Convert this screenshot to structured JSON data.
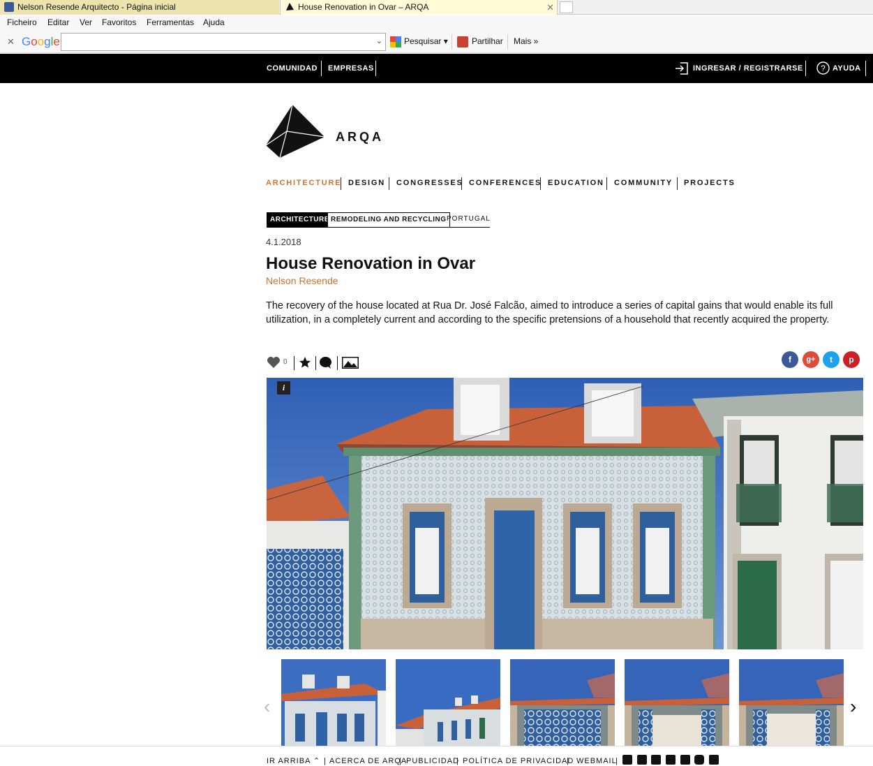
{
  "browser": {
    "tabs": [
      {
        "label": "Nelson Resende Arquitecto - Página inicial"
      },
      {
        "label": "House Renovation in Ovar – ARQA"
      }
    ],
    "menu": [
      "Ficheiro",
      "Editar",
      "Ver",
      "Favoritos",
      "Ferramentas",
      "Ajuda"
    ],
    "google_toolbar": {
      "logo": "Google",
      "search_value": "",
      "search_label": "Pesquisar",
      "share_label": "Partilhar",
      "more_label": "Mais"
    }
  },
  "topbar": {
    "left": [
      "COMUNIDAD",
      "EMPRESAS"
    ],
    "login": "INGRESAR / REGISTRARSE",
    "help": "AYUDA"
  },
  "logo": {
    "text": "ARQA"
  },
  "nav": [
    "ARCHITECTURE",
    "DESIGN",
    "CONGRESSES",
    "CONFERENCES",
    "EDUCATION",
    "COMMUNITY",
    "PROJECTS"
  ],
  "article": {
    "tags": [
      "ARCHITECTURE",
      "REMODELING AND RECYCLING",
      "PORTUGAL"
    ],
    "date": "4.1.2018",
    "title": "House Renovation in Ovar",
    "author": "Nelson Resende",
    "summary": "The recovery of the house located at Rua Dr. José Falcão, aimed to introduce a series of capital gains that would enable its full utilization, in a completely current and according to the specific pretensions of a household that recently acquired the property.",
    "likes": "0",
    "info_badge": "i"
  },
  "social": [
    {
      "name": "facebook",
      "glyph": "f",
      "color": "#3b5998"
    },
    {
      "name": "google-plus",
      "glyph": "g+",
      "color": "#dd4b39"
    },
    {
      "name": "twitter",
      "glyph": "t",
      "color": "#1da1f2"
    },
    {
      "name": "pinterest",
      "glyph": "p",
      "color": "#cb2027"
    }
  ],
  "footer": {
    "up": "IR ARRIBA",
    "links": [
      "ACERCA DE ARQA",
      "PUBLICIDAD",
      "POLÍTICA DE PRIVACIDAD",
      "WEBMAIL"
    ]
  },
  "colors": {
    "accent": "#d0722c",
    "bar": "#000000"
  }
}
